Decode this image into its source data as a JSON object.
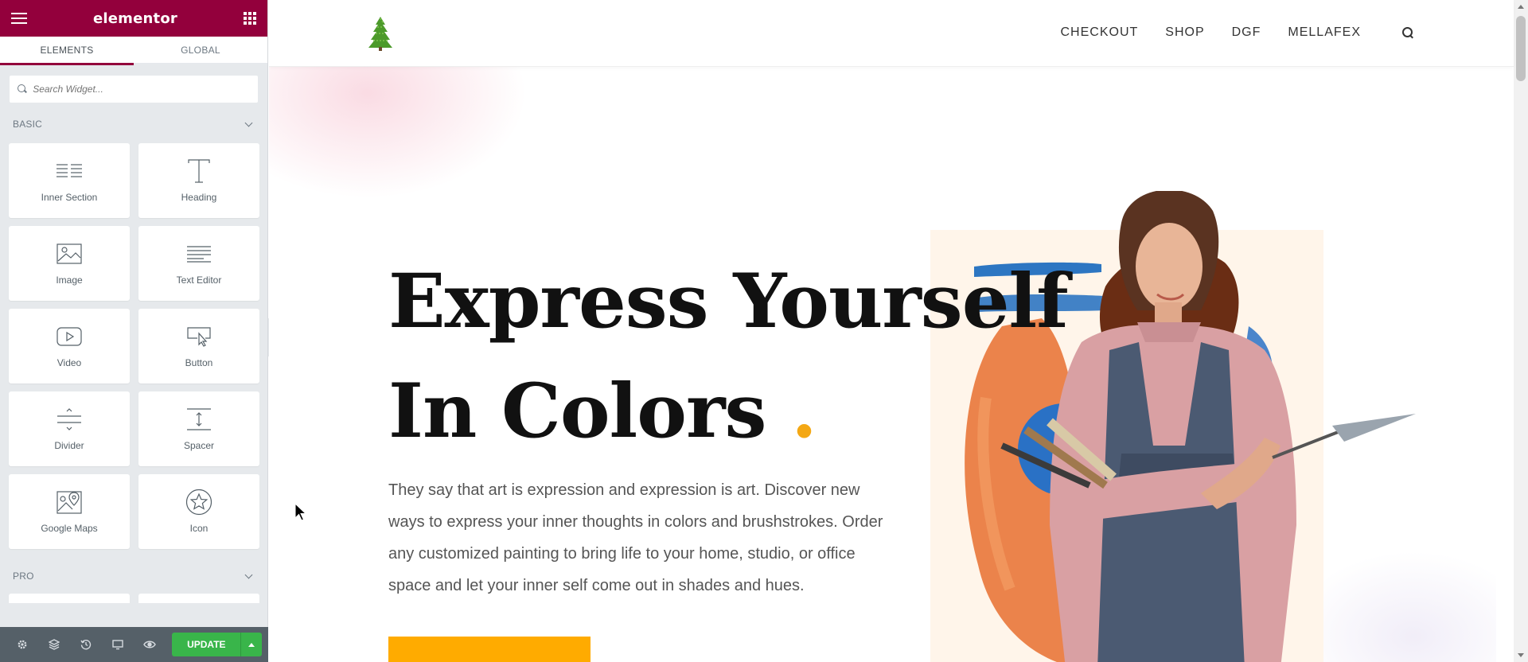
{
  "editor": {
    "brand": "elementor",
    "tabs": [
      {
        "label": "ELEMENTS"
      },
      {
        "label": "GLOBAL"
      }
    ],
    "search": {
      "placeholder": "Search Widget..."
    },
    "categories": {
      "basic": "BASIC",
      "pro": "PRO"
    },
    "widgets": [
      {
        "label": "Inner Section",
        "icon": "inner-section-icon"
      },
      {
        "label": "Heading",
        "icon": "heading-icon"
      },
      {
        "label": "Image",
        "icon": "image-icon"
      },
      {
        "label": "Text Editor",
        "icon": "text-editor-icon"
      },
      {
        "label": "Video",
        "icon": "video-icon"
      },
      {
        "label": "Button",
        "icon": "button-icon"
      },
      {
        "label": "Divider",
        "icon": "divider-icon"
      },
      {
        "label": "Spacer",
        "icon": "spacer-icon"
      },
      {
        "label": "Google Maps",
        "icon": "google-maps-icon"
      },
      {
        "label": "Icon",
        "icon": "star-icon"
      }
    ],
    "footer": {
      "update_label": "UPDATE"
    },
    "colors": {
      "brand": "#93003c",
      "update": "#39b54a",
      "footer_bg": "#556068"
    }
  },
  "site": {
    "nav": [
      {
        "label": "CHECKOUT"
      },
      {
        "label": "SHOP"
      },
      {
        "label": "DGF"
      },
      {
        "label": "MELLAFEX"
      }
    ],
    "hero": {
      "line1": "Express Yourself",
      "line2": "In Colors",
      "dot": ".",
      "paragraph": "They say that art is expression and expression is art. Discover new ways to express your inner thoughts in colors and brushstrokes. Order any customized painting to bring life to your home, studio, or office space and let your inner self come out in shades and hues."
    },
    "colors": {
      "accent": "#f4a814",
      "cta": "#ffab00"
    }
  }
}
